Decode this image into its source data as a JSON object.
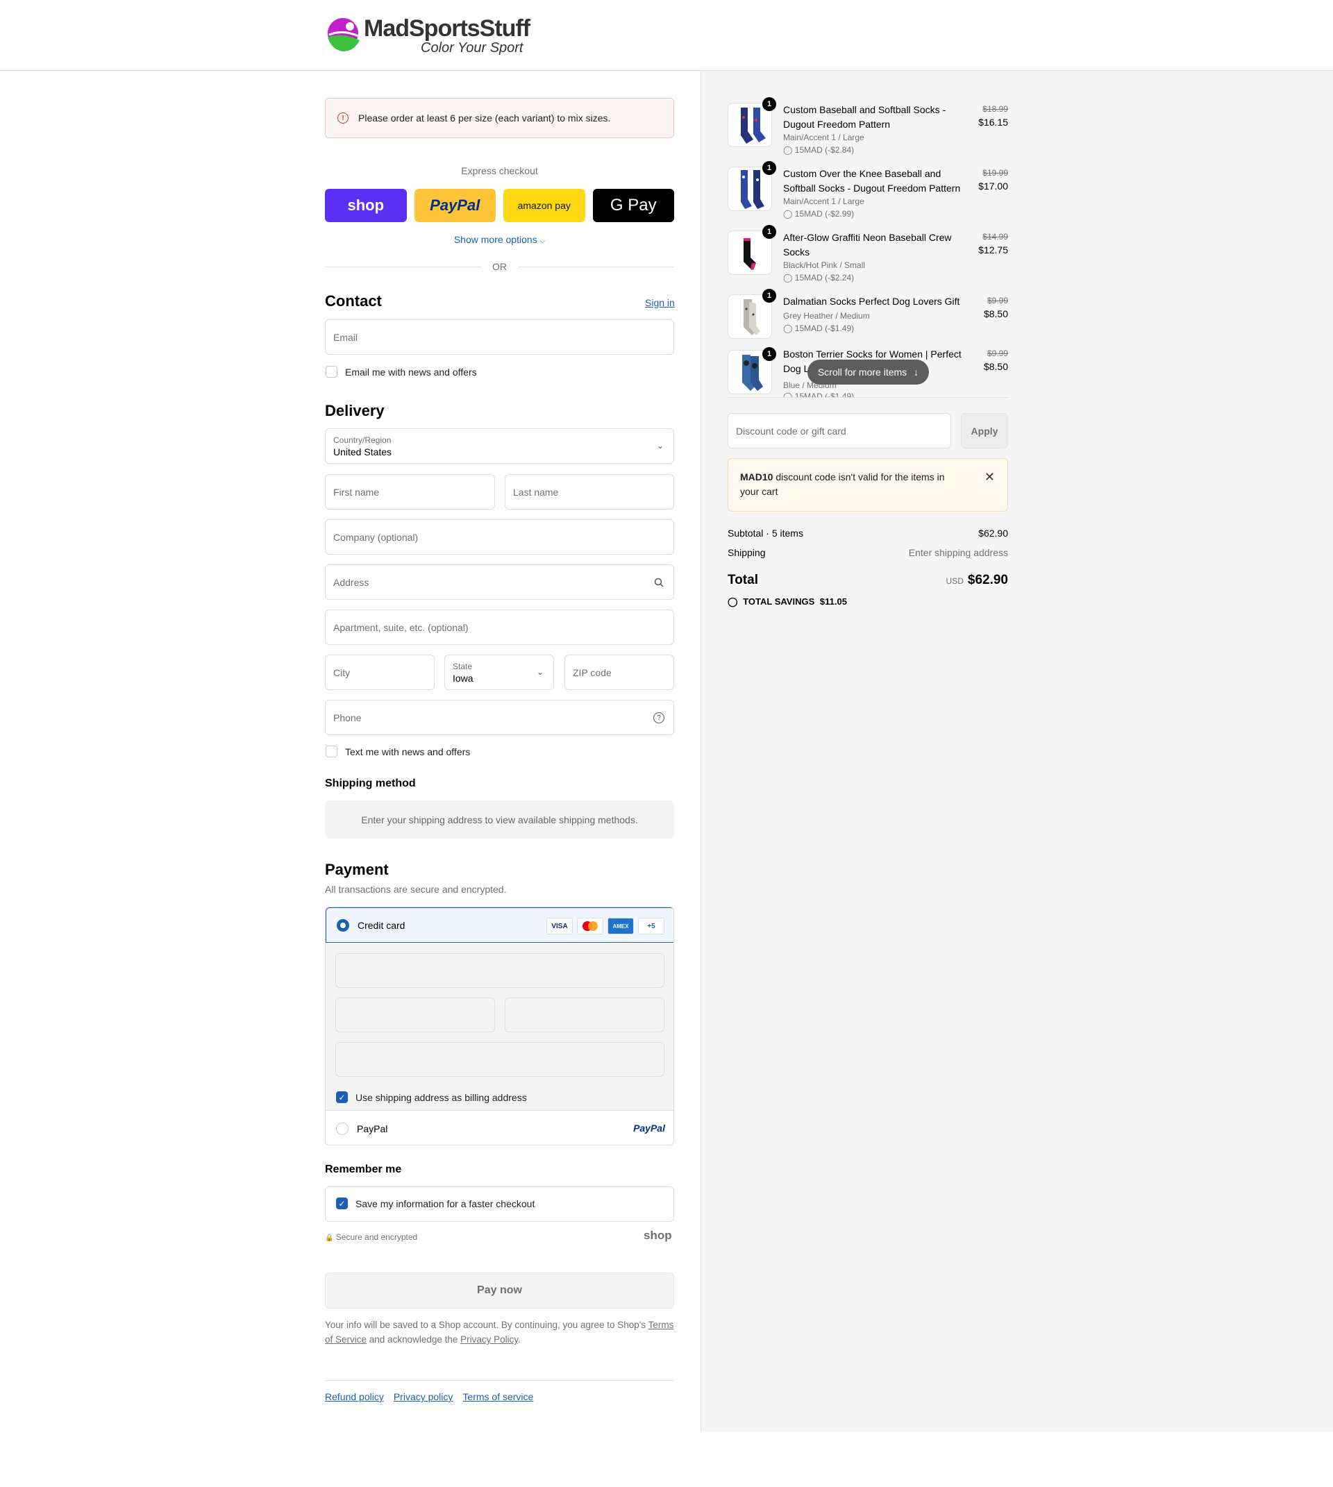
{
  "brand": {
    "name": "MadSportsStuff",
    "tagline": "Color Your Sport"
  },
  "alert": {
    "message": "Please order at least 6 per size (each variant) to mix sizes."
  },
  "express": {
    "title": "Express checkout",
    "shop": "shop",
    "paypal": "PayPal",
    "amazon": "amazon pay",
    "gpay": "G Pay",
    "more": "Show more options",
    "or": "OR"
  },
  "contact": {
    "title": "Contact",
    "sign_in": "Sign in",
    "email_placeholder": "Email",
    "news_label": "Email me with news and offers"
  },
  "delivery": {
    "title": "Delivery",
    "country_label": "Country/Region",
    "country_value": "United States",
    "first_name": "First name",
    "last_name": "Last name",
    "company": "Company (optional)",
    "address": "Address",
    "apartment": "Apartment, suite, etc. (optional)",
    "city": "City",
    "state_label": "State",
    "state_value": "Iowa",
    "zip": "ZIP code",
    "phone": "Phone",
    "text_label": "Text me with news and offers"
  },
  "shipping": {
    "title": "Shipping method",
    "message": "Enter your shipping address to view available shipping methods."
  },
  "payment": {
    "title": "Payment",
    "subtitle": "All transactions are secure and encrypted.",
    "credit_card": "Credit card",
    "cards": [
      "VISA",
      "MC",
      "AMEX",
      "+5"
    ],
    "billing_label": "Use shipping address as billing address",
    "paypal": "PayPal",
    "paypal_logo": "PayPal"
  },
  "remember": {
    "title": "Remember me",
    "save_label": "Save my information for a faster checkout",
    "secure": "Secure and encrypted",
    "shop": "shop"
  },
  "pay_now": "Pay now",
  "fine": {
    "text1": "Your info will be saved to a Shop account. By continuing, you agree to Shop's ",
    "tos": "Terms of Service",
    "text2": " and acknowledge the ",
    "privacy": "Privacy Policy",
    "text3": "."
  },
  "footer": {
    "refund": "Refund policy",
    "privacy": "Privacy policy",
    "terms": "Terms of service"
  },
  "cart": {
    "items": [
      {
        "qty": "1",
        "name": "Custom Baseball and Softball Socks - Dugout Freedom Pattern",
        "variant": "Main/Accent 1 / Large",
        "discount": "15MAD (-$2.84)",
        "old": "$18.99",
        "price": "$16.15"
      },
      {
        "qty": "1",
        "name": "Custom Over the Knee Baseball and Softball Socks - Dugout Freedom Pattern",
        "variant": "Main/Accent 1 / Large",
        "discount": "15MAD (-$2.99)",
        "old": "$19.99",
        "price": "$17.00"
      },
      {
        "qty": "1",
        "name": "After-Glow Graffiti Neon Baseball Crew Socks",
        "variant": "Black/Hot Pink / Small",
        "discount": "15MAD (-$2.24)",
        "old": "$14.99",
        "price": "$12.75"
      },
      {
        "qty": "1",
        "name": "Dalmatian Socks Perfect Dog Lovers Gift",
        "variant": "Grey Heather / Medium",
        "discount": "15MAD (-$1.49)",
        "old": "$9.99",
        "price": "$8.50"
      },
      {
        "qty": "1",
        "name": "Boston Terrier Socks for Women | Perfect Dog L",
        "variant": "Blue / Medium",
        "discount": "15MAD (-$1.49)",
        "old": "$9.99",
        "price": "$8.50"
      }
    ],
    "scroll_hint": "Scroll for more items",
    "discount_placeholder": "Discount code or gift card",
    "apply": "Apply",
    "warn_code": "MAD10",
    "warn_text": " discount code isn't valid for the items in your cart",
    "subtotal_label": "Subtotal · 5 items",
    "subtotal": "$62.90",
    "shipping_label": "Shipping",
    "shipping_value": "Enter shipping address",
    "total_label": "Total",
    "currency": "USD",
    "total": "$62.90",
    "savings_label": "TOTAL SAVINGS",
    "savings": "$11.05"
  }
}
